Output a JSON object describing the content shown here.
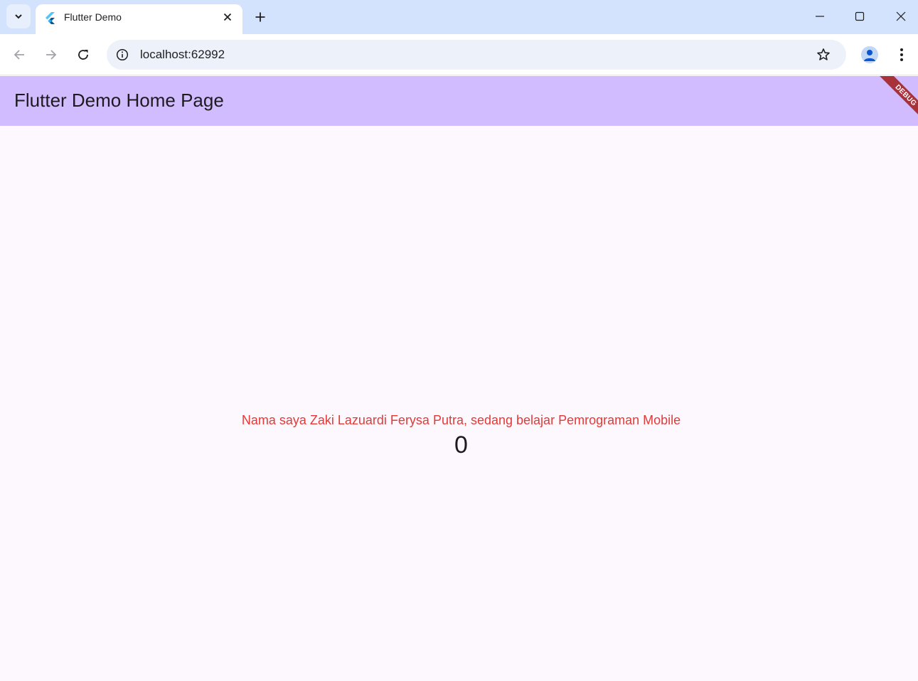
{
  "browser": {
    "tab": {
      "title": "Flutter Demo"
    },
    "omnibox": {
      "url": "localhost:62992"
    }
  },
  "app": {
    "title": "Flutter Demo Home Page",
    "debug_banner": "DEBUG",
    "message": "Nama saya Zaki Lazuardi Ferysa Putra, sedang belajar Pemrograman Mobile",
    "counter": "0"
  },
  "colors": {
    "tabstrip": "#d3e3fd",
    "appbar": "#d0bcfe",
    "page_background": "#fdf7fe",
    "message_text": "#e53935",
    "debug_banner": "#a8313a"
  },
  "icons": [
    "tab-search-icon",
    "flutter-icon",
    "close-icon",
    "plus-icon",
    "minimize-icon",
    "maximize-icon",
    "window-close-icon",
    "back-icon",
    "forward-icon",
    "reload-icon",
    "info-icon",
    "star-icon",
    "profile-icon",
    "more-vert-icon"
  ]
}
